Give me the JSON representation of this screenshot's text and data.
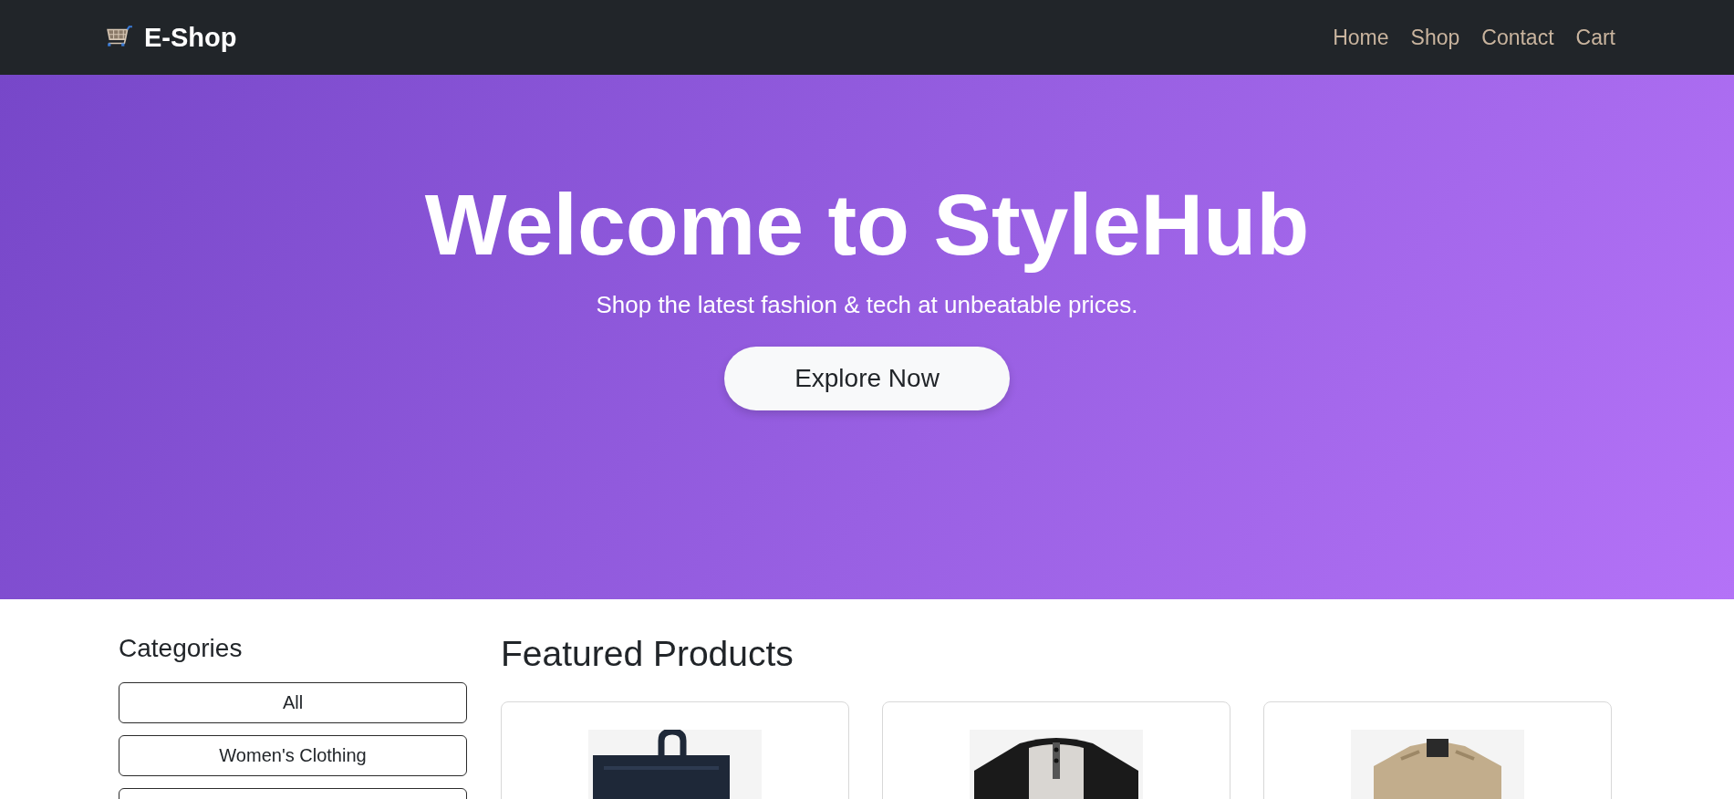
{
  "navbar": {
    "brand": "E-Shop",
    "links": [
      "Home",
      "Shop",
      "Contact",
      "Cart"
    ]
  },
  "hero": {
    "title": "Welcome to StyleHub",
    "subtitle": "Shop the latest fashion & tech at unbeatable prices.",
    "button": "Explore Now"
  },
  "sidebar": {
    "title": "Categories",
    "categories": [
      "All",
      "Women's Clothing"
    ]
  },
  "products": {
    "title": "Featured Products"
  }
}
